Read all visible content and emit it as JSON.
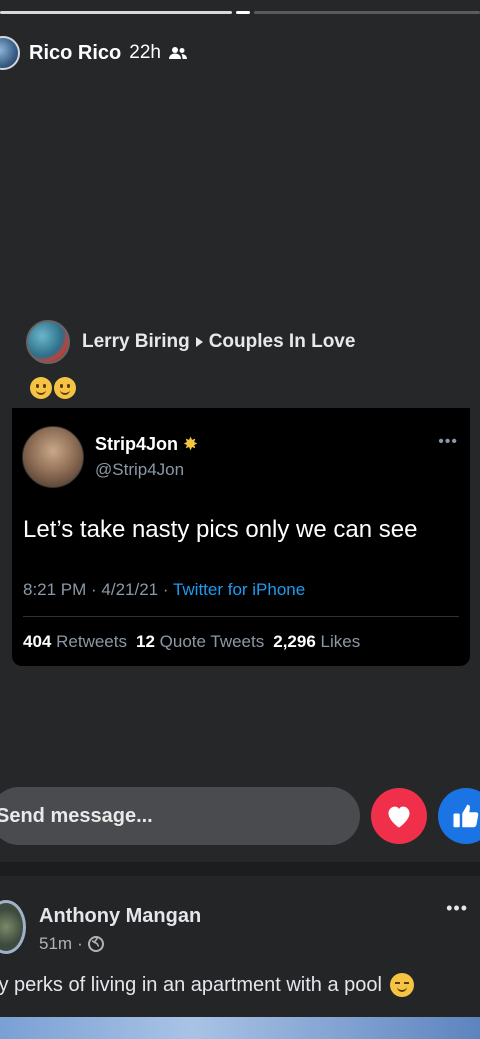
{
  "story": {
    "author": "Rico Rico",
    "time": "22h",
    "audience_icon": "friends-icon",
    "shared_post": {
      "author": "Lerry Biring",
      "group": "Couples In Love",
      "emojis": [
        "slightly-smiling-face",
        "slightly-smiling-face"
      ]
    },
    "tweet": {
      "name": "Strip4Jon",
      "handle": "@Strip4Jon",
      "text": "Let’s take nasty pics only we can see",
      "time": "8:21 PM · 4/21/21 · ",
      "source": "Twitter for iPhone",
      "retweets_count": "404",
      "retweets_label": "Retweets",
      "quotes_count": "12",
      "quotes_label": "Quote Tweets",
      "likes_count": "2,296",
      "likes_label": "Likes"
    },
    "reply": {
      "placeholder": "Send message...",
      "heart_icon": "heart-icon",
      "like_icon": "thumbs-up-icon"
    }
  },
  "post": {
    "author": "Anthony Mangan",
    "time": "51m",
    "privacy_icon": "globe-icon",
    "text": "ly perks of living in an apartment with a pool"
  },
  "colors": {
    "heart": "#f0304a",
    "like": "#1b74e4",
    "twitter_link": "#1d9bf0"
  }
}
